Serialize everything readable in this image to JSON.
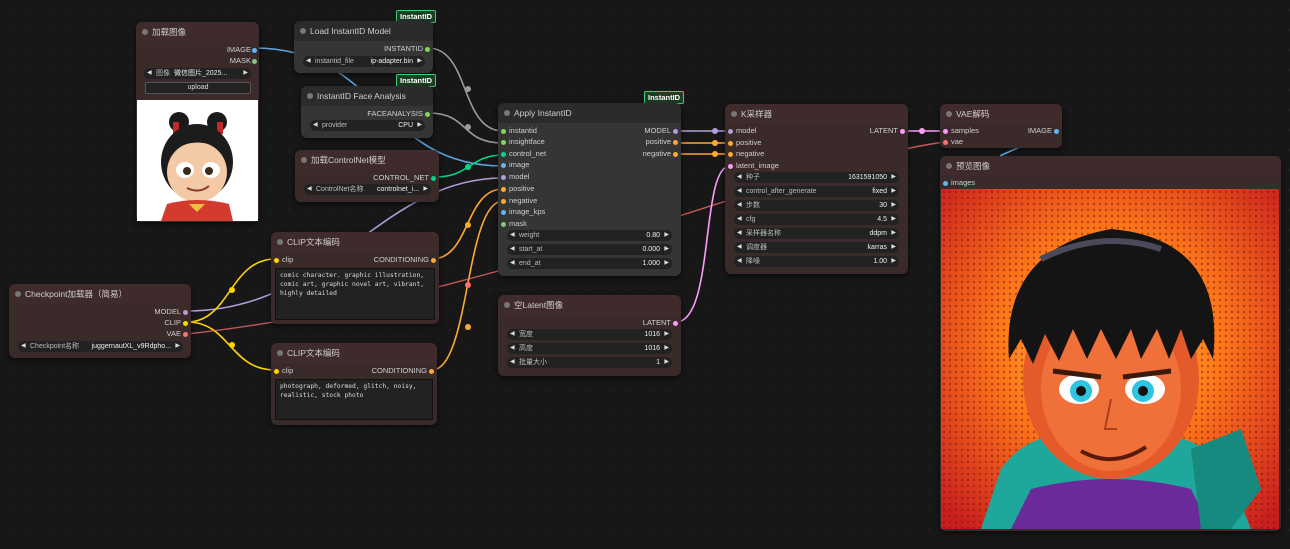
{
  "colors": {
    "image": "#64b5f6",
    "mask": "#81c784",
    "instantid": "#7ed957",
    "faceanalysis": "#7ed957",
    "controlnet": "#00d78d",
    "model": "#b39ddb",
    "clip": "#ffd500",
    "vae": "#ff6e6e",
    "conditioning": "#ffa931",
    "latent": "#ff9cf9"
  },
  "load_image": {
    "title": "加载图像",
    "out_image": "IMAGE",
    "out_mask": "MASK",
    "image_label": "图像",
    "image_value": "微信图片_2025...",
    "upload_label": "upload"
  },
  "load_instantid": {
    "badge": "InstantID",
    "title": "Load InstantID Model",
    "out": "INSTANTID",
    "w_label": "instantid_file",
    "w_value": "ip-adapter.bin"
  },
  "face_analysis": {
    "badge": "InstantID",
    "title": "InstantID Face Analysis",
    "out": "FACEANALYSIS",
    "w_label": "provider",
    "w_value": "CPU"
  },
  "controlnet_loader": {
    "title": "加载ControlNet模型",
    "out": "CONTROL_NET",
    "w_label": "ControlNet名称",
    "w_value": "controlnet_i..."
  },
  "checkpoint": {
    "title": "Checkpoint加载器（简易）",
    "out_model": "MODEL",
    "out_clip": "CLIP",
    "out_vae": "VAE",
    "w_label": "Checkpoint名称",
    "w_value": "juggernautXL_v9Rdpho..."
  },
  "clip_pos": {
    "title": "CLIP文本编码",
    "in_clip": "clip",
    "out": "CONDITIONING",
    "text": "comic character. graphic illustration, comic art, graphic novel art, vibrant, highly detailed"
  },
  "clip_neg": {
    "title": "CLIP文本编码",
    "in_clip": "clip",
    "out": "CONDITIONING",
    "text": "photograph, deformed, glitch, noisy, realistic, stock photo"
  },
  "apply_instantid": {
    "badge": "InstantID",
    "title": "Apply InstantID",
    "inputs": [
      "instantid",
      "insightface",
      "control_net",
      "image",
      "model",
      "positive",
      "negative",
      "image_kps",
      "mask"
    ],
    "outputs": [
      "MODEL",
      "positive",
      "negative"
    ],
    "widgets": [
      {
        "label": "weight",
        "value": "0.80"
      },
      {
        "label": "start_at",
        "value": "0.000"
      },
      {
        "label": "end_at",
        "value": "1.000"
      }
    ]
  },
  "empty_latent": {
    "title": "空Latent图像",
    "out": "LATENT",
    "widgets": [
      {
        "label": "宽度",
        "value": "1016"
      },
      {
        "label": "高度",
        "value": "1016"
      },
      {
        "label": "批量大小",
        "value": "1"
      }
    ]
  },
  "ksampler": {
    "title": "K采样器",
    "inputs": [
      "model",
      "positive",
      "negative",
      "latent_image"
    ],
    "out": "LATENT",
    "widgets": [
      {
        "label": "种子",
        "value": "1631591050"
      },
      {
        "label": "control_after_generate",
        "value": "fixed"
      },
      {
        "label": "步数",
        "value": "30"
      },
      {
        "label": "cfg",
        "value": "4.5"
      },
      {
        "label": "采样器名称",
        "value": "ddpm"
      },
      {
        "label": "调度器",
        "value": "karras"
      },
      {
        "label": "降噪",
        "value": "1.00"
      }
    ]
  },
  "vae_decode": {
    "title": "VAE解码",
    "in_samples": "samples",
    "in_vae": "vae",
    "out": "IMAGE"
  },
  "preview": {
    "title": "预览图像",
    "in_images": "images"
  }
}
